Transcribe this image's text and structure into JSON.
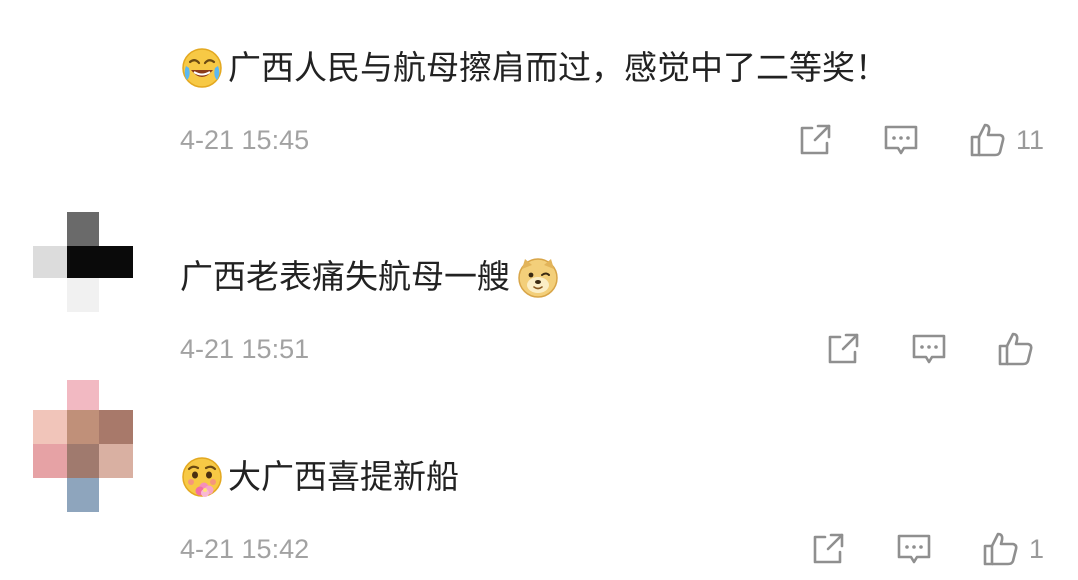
{
  "comments": [
    {
      "text": "广西人民与航母擦肩而过，感觉中了二等奖！",
      "emoji": "crying-laughing-emoji",
      "timestamp": "4-21 15:45",
      "likes": "11"
    },
    {
      "text": "广西老表痛失航母一艘",
      "emoji": "doge-emoji",
      "timestamp": "4-21 15:51",
      "likes": ""
    },
    {
      "text": "大广西喜提新船",
      "emoji": "flower-cheer-emoji",
      "timestamp": "4-21 15:42",
      "likes": "1"
    }
  ],
  "icons": {
    "share": "share-icon",
    "reply": "comment-icon",
    "like": "thumbs-up-icon"
  },
  "colors": {
    "text": "#222222",
    "meta": "#a2a2a2",
    "icon": "#8f8f8f"
  }
}
